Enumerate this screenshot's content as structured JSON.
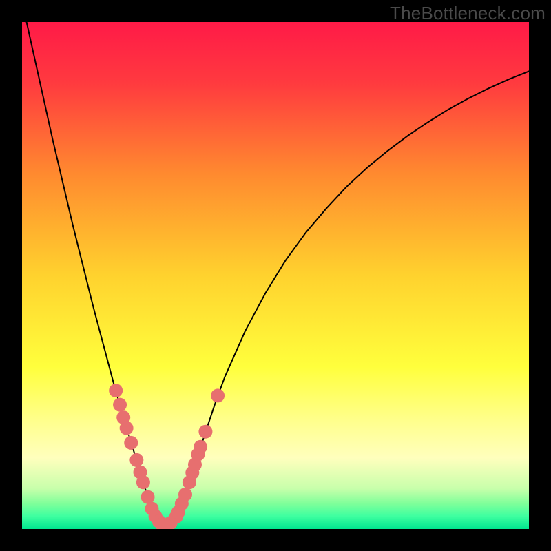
{
  "watermark": "TheBottleneck.com",
  "chart_data": {
    "type": "line",
    "title": "",
    "xlabel": "",
    "ylabel": "",
    "xlim": [
      0,
      100
    ],
    "ylim": [
      0,
      100
    ],
    "grid": false,
    "legend": false,
    "background": {
      "type": "vertical-gradient",
      "stops": [
        {
          "offset": 0.0,
          "color": "#ff1a47"
        },
        {
          "offset": 0.12,
          "color": "#ff3a3f"
        },
        {
          "offset": 0.3,
          "color": "#ff8a2f"
        },
        {
          "offset": 0.5,
          "color": "#ffd22e"
        },
        {
          "offset": 0.68,
          "color": "#ffff3c"
        },
        {
          "offset": 0.78,
          "color": "#ffff88"
        },
        {
          "offset": 0.86,
          "color": "#ffffbd"
        },
        {
          "offset": 0.92,
          "color": "#c8ffab"
        },
        {
          "offset": 0.95,
          "color": "#7fff9a"
        },
        {
          "offset": 0.975,
          "color": "#3dffa0"
        },
        {
          "offset": 1.0,
          "color": "#00e58f"
        }
      ]
    },
    "series": [
      {
        "name": "curve",
        "color": "#000000",
        "stroke_width": 2,
        "x": [
          0.0,
          2.0,
          4.0,
          6.0,
          8.0,
          10.0,
          12.0,
          14.0,
          16.0,
          18.0,
          20.0,
          22.0,
          23.0,
          24.0,
          25.0,
          26.0,
          27.0,
          28.0,
          29.0,
          30.0,
          31.0,
          32.0,
          34.0,
          36.0,
          38.0,
          40.0,
          44.0,
          48.0,
          52.0,
          56.0,
          60.0,
          64.0,
          68.0,
          72.0,
          76.0,
          80.0,
          84.0,
          88.0,
          92.0,
          96.0,
          100.0
        ],
        "y": [
          104.0,
          95.0,
          86.0,
          77.0,
          68.5,
          60.0,
          52.0,
          44.0,
          36.5,
          29.0,
          22.0,
          15.5,
          12.0,
          8.9,
          5.8,
          3.3,
          1.6,
          0.8,
          0.8,
          1.6,
          3.3,
          6.0,
          12.2,
          18.5,
          24.5,
          30.0,
          39.0,
          46.5,
          53.0,
          58.5,
          63.2,
          67.5,
          71.2,
          74.5,
          77.5,
          80.2,
          82.7,
          84.9,
          86.9,
          88.7,
          90.3
        ]
      },
      {
        "name": "dots",
        "type": "scatter",
        "color": "#e76f6f",
        "marker_size": 10,
        "points": [
          {
            "x": 18.5,
            "y": 27.3
          },
          {
            "x": 19.3,
            "y": 24.5
          },
          {
            "x": 20.0,
            "y": 22.0
          },
          {
            "x": 20.6,
            "y": 19.9
          },
          {
            "x": 21.5,
            "y": 17.0
          },
          {
            "x": 22.6,
            "y": 13.6
          },
          {
            "x": 23.3,
            "y": 11.2
          },
          {
            "x": 23.9,
            "y": 9.2
          },
          {
            "x": 24.8,
            "y": 6.3
          },
          {
            "x": 25.6,
            "y": 4.0
          },
          {
            "x": 26.3,
            "y": 2.5
          },
          {
            "x": 27.0,
            "y": 1.5
          },
          {
            "x": 27.6,
            "y": 0.9
          },
          {
            "x": 28.4,
            "y": 0.8
          },
          {
            "x": 29.3,
            "y": 1.2
          },
          {
            "x": 30.4,
            "y": 2.4
          },
          {
            "x": 30.8,
            "y": 3.3
          },
          {
            "x": 31.5,
            "y": 5.0
          },
          {
            "x": 32.2,
            "y": 6.8
          },
          {
            "x": 33.0,
            "y": 9.2
          },
          {
            "x": 33.6,
            "y": 11.1
          },
          {
            "x": 34.1,
            "y": 12.7
          },
          {
            "x": 34.7,
            "y": 14.7
          },
          {
            "x": 35.2,
            "y": 16.2
          },
          {
            "x": 36.2,
            "y": 19.2
          },
          {
            "x": 38.6,
            "y": 26.3
          }
        ]
      }
    ]
  }
}
